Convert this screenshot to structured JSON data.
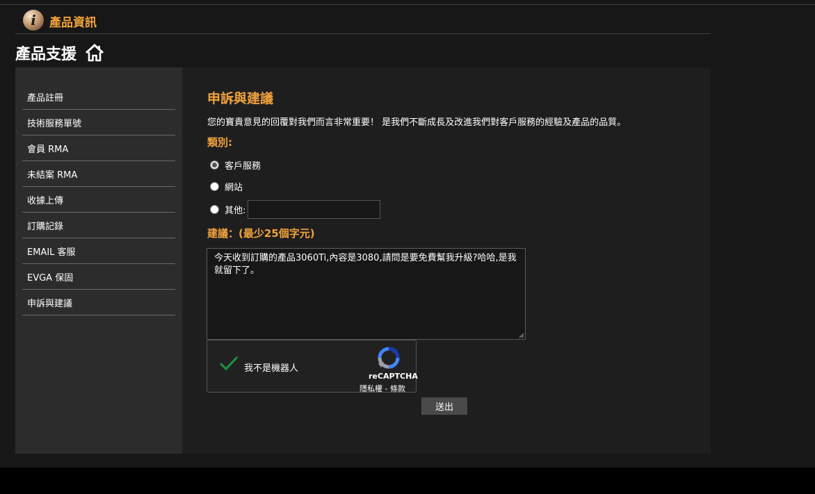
{
  "header": {
    "title": "產品資訊",
    "icon": "info-icon"
  },
  "page": {
    "title": "產品支援",
    "home_icon": "home-icon"
  },
  "sidebar": {
    "items": [
      {
        "label": "產品註冊"
      },
      {
        "label": "技術服務單號"
      },
      {
        "label": "會員 RMA"
      },
      {
        "label": "未結案 RMA"
      },
      {
        "label": "收據上傳"
      },
      {
        "label": "訂購記錄"
      },
      {
        "label": "EMAIL 客服"
      },
      {
        "label": "EVGA 保固"
      },
      {
        "label": "申訴與建議"
      }
    ]
  },
  "form": {
    "title": "申訴與建議",
    "intro": "您的寶貴意見的回覆對我們而言非常重要！ 是我們不斷成長及改進我們對客戶服務的經驗及產品的品質。",
    "category_label": "類別:",
    "options": [
      {
        "label": "客戶服務",
        "checked": true
      },
      {
        "label": "網站",
        "checked": false
      },
      {
        "label": "其他:",
        "checked": false
      }
    ],
    "other_value": "",
    "suggestion_label": "建議：(最少25個字元)",
    "suggestion_text": "今天收到訂購的產品3060Ti,內容是3080,請問是要免費幫我升級?哈哈,是我就留下了。",
    "captcha": {
      "label": "我不是機器人",
      "brand": "reCAPTCHA",
      "terms": "隱私權 - 條款"
    },
    "submit_label": "送出"
  },
  "colors": {
    "accent": "#f2a33a",
    "background": "#181718",
    "sidebar": "#2d2c2d",
    "panel": "#1f1e1f",
    "check": "#1e8e3e"
  }
}
